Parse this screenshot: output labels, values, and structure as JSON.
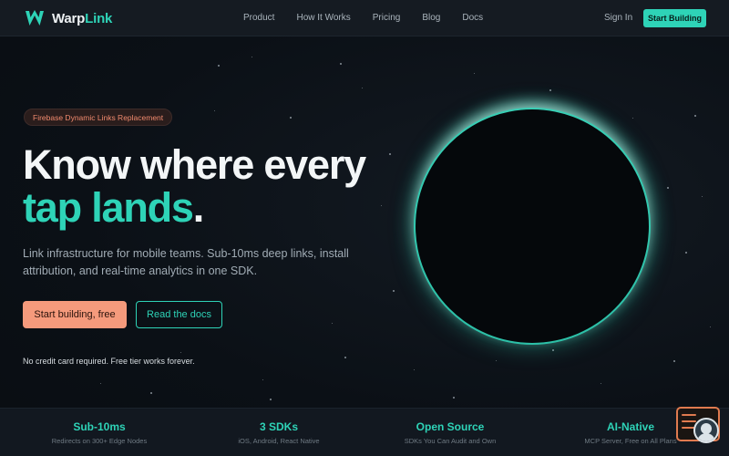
{
  "nav": {
    "logo_word": "Warp",
    "logo_accent": "Link",
    "links": [
      "Product",
      "How It Works",
      "Pricing",
      "Blog",
      "Docs"
    ],
    "sign_in": "Sign In",
    "cta": "Start Building"
  },
  "hero": {
    "badge": "Firebase Dynamic Links Replacement",
    "headline_line1": "Know where every",
    "headline_accent": "tap lands",
    "headline_period": ".",
    "subtitle": "Link infrastructure for mobile teams. Sub-10ms deep links, install attribution, and real-time analytics in one SDK.",
    "primary_button": "Start building, free",
    "secondary_button": "Read the docs",
    "note": "No credit card required. Free tier works forever."
  },
  "stats": [
    {
      "title": "Sub-10ms",
      "subtitle": "Redirects on 300+ Edge Nodes"
    },
    {
      "title": "3 SDKs",
      "subtitle": "iOS, Android, React Native"
    },
    {
      "title": "Open Source",
      "subtitle": "SDKs You Can Audit and Own"
    },
    {
      "title": "AI-Native",
      "subtitle": "MCP Server, Free on All Plans"
    }
  ],
  "colors": {
    "accent": "#2ed3b7",
    "cta_coral": "#f59a7c",
    "badge_text": "#f08a6e",
    "background": "#0b1016"
  },
  "icons": {
    "logo": "warplink-w-logo",
    "widget": "chat-widget-icon",
    "avatar": "user-avatar-icon"
  }
}
